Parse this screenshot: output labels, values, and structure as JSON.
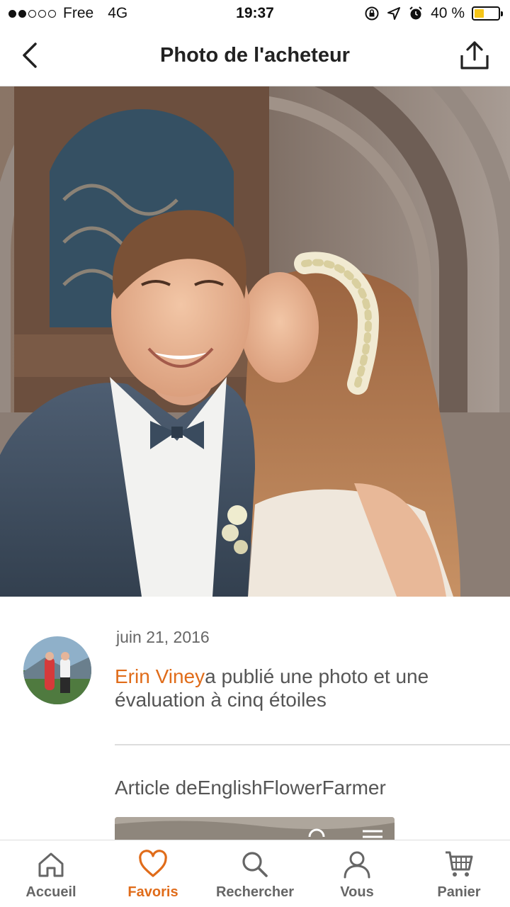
{
  "status_bar": {
    "carrier": "Free",
    "network": "4G",
    "time": "19:37",
    "battery": "40 %"
  },
  "nav": {
    "title": "Photo de l'acheteur",
    "back_icon": "chevron-left-icon",
    "share_icon": "share-icon"
  },
  "review": {
    "date": "juin 21, 2016",
    "reviewer_name": "Erin Viney",
    "action_text": "a publié une photo et une évaluation à cinq étoiles",
    "article_label": "Article de",
    "shop_name": "EnglishFlowerFarmer"
  },
  "tabs": [
    {
      "label": "Accueil",
      "icon": "home-icon",
      "active": false
    },
    {
      "label": "Favoris",
      "icon": "heart-icon",
      "active": true
    },
    {
      "label": "Rechercher",
      "icon": "search-icon",
      "active": false
    },
    {
      "label": "Vous",
      "icon": "user-icon",
      "active": false
    },
    {
      "label": "Panier",
      "icon": "cart-icon",
      "active": false
    }
  ],
  "colors": {
    "accent": "#e06c1a",
    "text": "#555555",
    "battery": "#f5c518"
  }
}
